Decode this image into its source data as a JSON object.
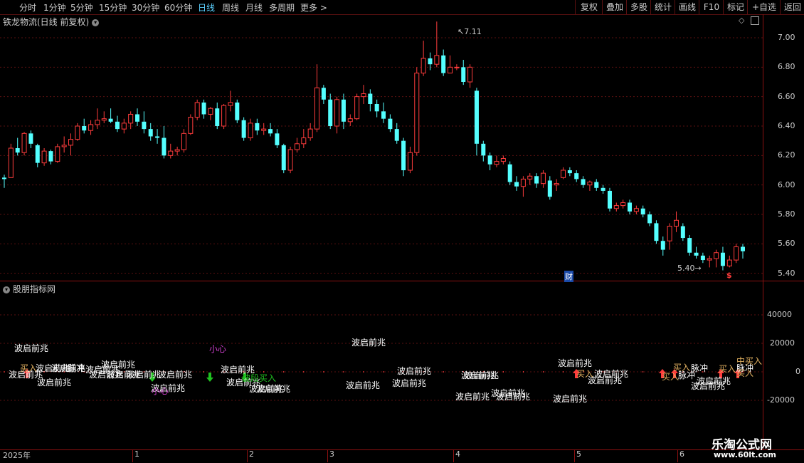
{
  "toolbar": {
    "periods": [
      "分时",
      "1分钟",
      "5分钟",
      "15分钟",
      "30分钟",
      "60分钟",
      "日线",
      "周线",
      "月线",
      "多周期",
      "更多 >"
    ],
    "active_period": "日线",
    "buttons": [
      "复权",
      "叠加",
      "多股",
      "统计",
      "画线",
      "F10",
      "标记",
      "+自选",
      "返回"
    ]
  },
  "main_panel": {
    "title": "铁龙物流(日线 前复权)",
    "high_label": "7.11",
    "low_label": "5.40",
    "cai_marker": "财",
    "dollar_marker": "$",
    "y_ticks": [
      "7.00",
      "6.80",
      "6.60",
      "6.40",
      "6.20",
      "6.00",
      "5.80",
      "5.60",
      "5.40"
    ]
  },
  "indicator_panel": {
    "title": "股朋指标网",
    "y_ticks": [
      "40000",
      "20000",
      "0",
      "-20000"
    ],
    "signals": [
      {
        "text": "波启前兆",
        "color": "#ffffff"
      },
      {
        "text": "买入",
        "color": "#e0b060"
      },
      {
        "text": "小心",
        "color": "#d040d0"
      },
      {
        "text": "波段买入",
        "color": "#20c020"
      },
      {
        "text": "买入",
        "color": "#e0b060"
      },
      {
        "text": "脉冲",
        "color": "#ffffff"
      },
      {
        "text": "中买入",
        "color": "#e0b060"
      }
    ]
  },
  "x_axis": {
    "labels": [
      "2025年",
      "1",
      "2",
      "3",
      "4",
      "5",
      "6"
    ]
  },
  "watermark": {
    "line1": "乐淘公式网",
    "line2": "www.60lt.com"
  },
  "colors": {
    "up": "#ff3c3c",
    "down": "#54ffff",
    "grid": "#5a1010",
    "accent": "#5bd0ff"
  },
  "chart_data": {
    "type": "candlestick",
    "title": "铁龙物流(日线 前复权)",
    "ylim": [
      5.35,
      7.15
    ],
    "x_labels": [
      "2025年",
      "1",
      "2",
      "3",
      "4",
      "5",
      "6"
    ],
    "candles": [
      [
        6.05,
        6.07,
        5.98,
        6.04
      ],
      [
        6.05,
        6.28,
        6.05,
        6.25
      ],
      [
        6.25,
        6.32,
        6.2,
        6.22
      ],
      [
        6.22,
        6.36,
        6.2,
        6.35
      ],
      [
        6.35,
        6.37,
        6.25,
        6.28
      ],
      [
        6.27,
        6.28,
        6.12,
        6.15
      ],
      [
        6.15,
        6.25,
        6.13,
        6.23
      ],
      [
        6.23,
        6.24,
        6.14,
        6.16
      ],
      [
        6.16,
        6.28,
        6.15,
        6.26
      ],
      [
        6.26,
        6.33,
        6.22,
        6.27
      ],
      [
        6.27,
        6.35,
        6.2,
        6.31
      ],
      [
        6.31,
        6.42,
        6.3,
        6.4
      ],
      [
        6.4,
        6.45,
        6.35,
        6.37
      ],
      [
        6.37,
        6.44,
        6.34,
        6.41
      ],
      [
        6.41,
        6.52,
        6.38,
        6.44
      ],
      [
        6.44,
        6.5,
        6.42,
        6.45
      ],
      [
        6.45,
        6.52,
        6.42,
        6.43
      ],
      [
        6.43,
        6.47,
        6.36,
        6.38
      ],
      [
        6.38,
        6.45,
        6.35,
        6.42
      ],
      [
        6.42,
        6.5,
        6.38,
        6.48
      ],
      [
        6.48,
        6.52,
        6.4,
        6.43
      ],
      [
        6.43,
        6.5,
        6.35,
        6.38
      ],
      [
        6.38,
        6.42,
        6.3,
        6.33
      ],
      [
        6.33,
        6.38,
        6.28,
        6.32
      ],
      [
        6.32,
        6.4,
        6.18,
        6.2
      ],
      [
        6.2,
        6.28,
        6.18,
        6.23
      ],
      [
        6.23,
        6.26,
        6.2,
        6.24
      ],
      [
        6.24,
        6.38,
        6.22,
        6.35
      ],
      [
        6.35,
        6.48,
        6.34,
        6.46
      ],
      [
        6.46,
        6.58,
        6.44,
        6.56
      ],
      [
        6.56,
        6.58,
        6.45,
        6.48
      ],
      [
        6.48,
        6.53,
        6.44,
        6.52
      ],
      [
        6.52,
        6.56,
        6.38,
        6.4
      ],
      [
        6.4,
        6.55,
        6.38,
        6.54
      ],
      [
        6.54,
        6.64,
        6.5,
        6.56
      ],
      [
        6.56,
        6.58,
        6.42,
        6.44
      ],
      [
        6.44,
        6.46,
        6.3,
        6.32
      ],
      [
        6.32,
        6.45,
        6.3,
        6.42
      ],
      [
        6.42,
        6.45,
        6.34,
        6.37
      ],
      [
        6.37,
        6.42,
        6.34,
        6.38
      ],
      [
        6.38,
        6.42,
        6.33,
        6.35
      ],
      [
        6.35,
        6.38,
        6.25,
        6.27
      ],
      [
        6.27,
        6.28,
        6.08,
        6.1
      ],
      [
        6.1,
        6.26,
        6.08,
        6.24
      ],
      [
        6.24,
        6.32,
        6.22,
        6.28
      ],
      [
        6.28,
        6.38,
        6.25,
        6.32
      ],
      [
        6.32,
        6.42,
        6.3,
        6.38
      ],
      [
        6.38,
        6.82,
        6.36,
        6.66
      ],
      [
        6.66,
        6.68,
        6.55,
        6.58
      ],
      [
        6.58,
        6.62,
        6.38,
        6.4
      ],
      [
        6.4,
        6.6,
        6.35,
        6.58
      ],
      [
        6.58,
        6.62,
        6.38,
        6.43
      ],
      [
        6.43,
        6.48,
        6.4,
        6.45
      ],
      [
        6.45,
        6.62,
        6.44,
        6.6
      ],
      [
        6.6,
        6.68,
        6.55,
        6.62
      ],
      [
        6.62,
        6.65,
        6.5,
        6.55
      ],
      [
        6.55,
        6.58,
        6.46,
        6.5
      ],
      [
        6.5,
        6.56,
        6.42,
        6.45
      ],
      [
        6.45,
        6.48,
        6.36,
        6.38
      ],
      [
        6.38,
        6.42,
        6.28,
        6.3
      ],
      [
        6.3,
        6.32,
        6.06,
        6.1
      ],
      [
        6.1,
        6.26,
        6.08,
        6.22
      ],
      [
        6.22,
        6.8,
        6.2,
        6.76
      ],
      [
        6.76,
        6.98,
        6.74,
        6.86
      ],
      [
        6.86,
        6.9,
        6.78,
        6.82
      ],
      [
        6.82,
        7.11,
        6.8,
        6.88
      ],
      [
        6.88,
        6.92,
        6.74,
        6.76
      ],
      [
        6.76,
        6.88,
        6.76,
        6.8
      ],
      [
        6.8,
        6.82,
        6.78,
        6.8
      ],
      [
        6.8,
        6.85,
        6.68,
        6.7
      ],
      [
        6.7,
        6.82,
        6.66,
        6.8
      ],
      [
        6.64,
        6.66,
        6.2,
        6.28
      ],
      [
        6.28,
        6.3,
        6.16,
        6.2
      ],
      [
        6.2,
        6.22,
        6.1,
        6.14
      ],
      [
        6.14,
        6.2,
        6.12,
        6.16
      ],
      [
        6.16,
        6.2,
        6.14,
        6.18
      ],
      [
        6.14,
        6.16,
        6.0,
        6.02
      ],
      [
        6.02,
        6.06,
        5.96,
        5.99
      ],
      [
        5.99,
        6.06,
        5.92,
        6.04
      ],
      [
        6.04,
        6.08,
        6.0,
        6.06
      ],
      [
        6.06,
        6.08,
        5.98,
        6.01
      ],
      [
        6.01,
        6.1,
        5.98,
        6.08
      ],
      [
        6.03,
        6.06,
        5.9,
        5.92
      ],
      [
        6.0,
        6.04,
        5.96,
        6.01
      ],
      [
        6.05,
        6.12,
        6.04,
        6.1
      ],
      [
        6.1,
        6.12,
        6.06,
        6.08
      ],
      [
        6.08,
        6.1,
        6.02,
        6.04
      ],
      [
        6.04,
        6.06,
        5.98,
        6.0
      ],
      [
        6.0,
        6.03,
        5.96,
        6.02
      ],
      [
        6.02,
        6.04,
        5.96,
        5.98
      ],
      [
        5.98,
        6.0,
        5.94,
        5.96
      ],
      [
        5.96,
        5.98,
        5.82,
        5.84
      ],
      [
        5.84,
        5.88,
        5.82,
        5.86
      ],
      [
        5.86,
        5.9,
        5.84,
        5.88
      ],
      [
        5.88,
        5.9,
        5.8,
        5.82
      ],
      [
        5.82,
        5.86,
        5.8,
        5.84
      ],
      [
        5.84,
        5.86,
        5.78,
        5.8
      ],
      [
        5.8,
        5.82,
        5.72,
        5.74
      ],
      [
        5.74,
        5.76,
        5.6,
        5.62
      ],
      [
        5.62,
        5.65,
        5.52,
        5.56
      ],
      [
        5.62,
        5.74,
        5.56,
        5.72
      ],
      [
        5.72,
        5.82,
        5.68,
        5.76
      ],
      [
        5.72,
        5.74,
        5.62,
        5.64
      ],
      [
        5.64,
        5.66,
        5.52,
        5.54
      ],
      [
        5.54,
        5.58,
        5.5,
        5.52
      ],
      [
        5.52,
        5.54,
        5.47,
        5.49
      ],
      [
        5.49,
        5.52,
        5.44,
        5.5
      ],
      [
        5.5,
        5.56,
        5.44,
        5.54
      ],
      [
        5.54,
        5.58,
        5.42,
        5.45
      ],
      [
        5.45,
        5.52,
        5.44,
        5.49
      ],
      [
        5.49,
        5.6,
        5.47,
        5.58
      ],
      [
        5.58,
        5.6,
        5.5,
        5.55
      ]
    ]
  }
}
